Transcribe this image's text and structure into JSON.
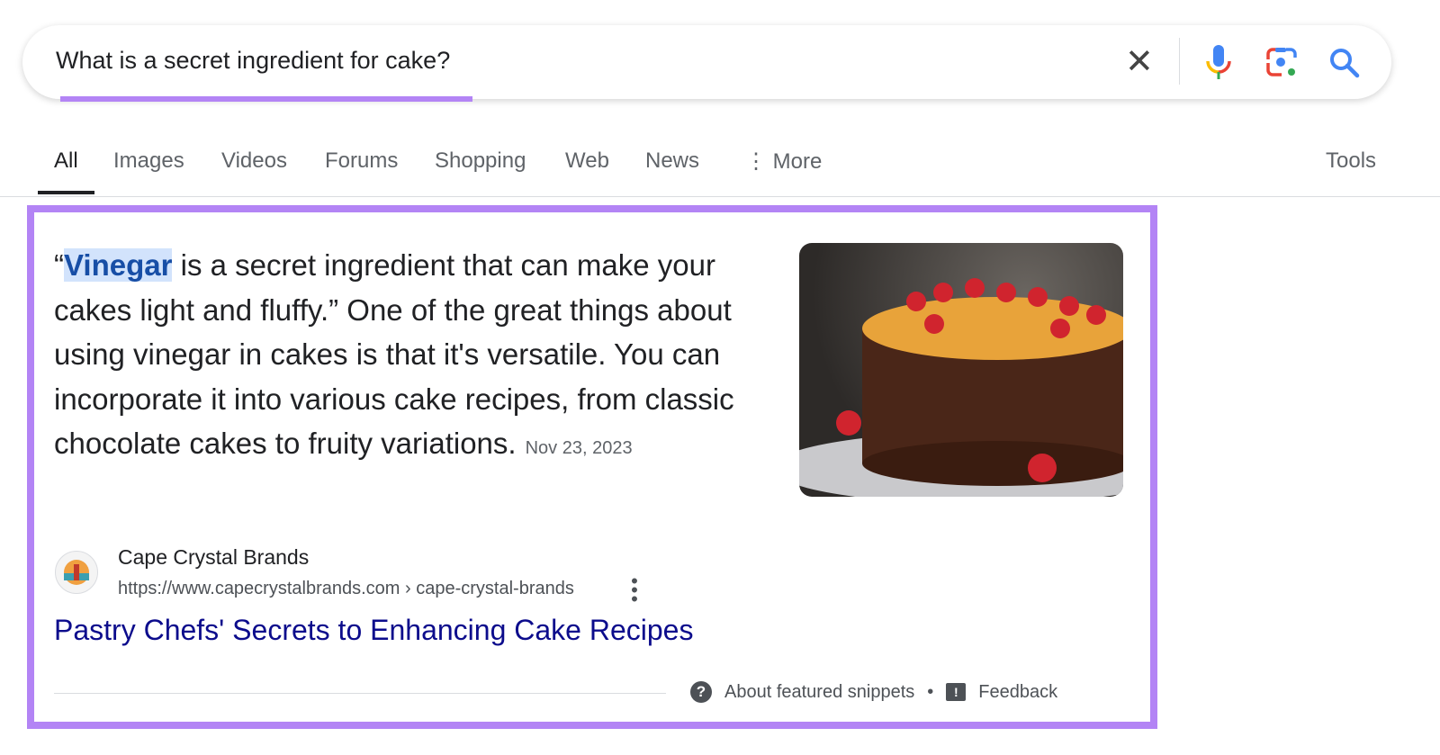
{
  "search": {
    "query": "What is a secret ingredient for cake?",
    "clear_icon": "close-icon",
    "voice_icon": "microphone-icon",
    "lens_icon": "google-lens-icon",
    "search_icon": "search-icon",
    "highlight_color": "#b384f5"
  },
  "tabs": [
    {
      "label": "All",
      "active": true
    },
    {
      "label": "Images"
    },
    {
      "label": "Videos"
    },
    {
      "label": "Forums"
    },
    {
      "label": "Shopping"
    },
    {
      "label": "Web"
    },
    {
      "label": "News"
    },
    {
      "label": "More"
    }
  ],
  "tools_label": "Tools",
  "snippet": {
    "open_quote": "“",
    "highlight": "Vinegar",
    "text": " is a secret ingredient that can make your cakes light and fluffy.” One of the great things about using vinegar in cakes is that it's versatile. You can incorporate it into various cake recipes, from classic chocolate cakes to fruity variations.",
    "date": "Nov 23, 2023",
    "image": "chocolate-cake-with-strawberries",
    "source_name": "Cape Crystal Brands",
    "source_url": "https://www.capecrystalbrands.com › cape-crystal-brands",
    "title": "Pastry Chefs' Secrets to Enhancing Cake Recipes",
    "about_label": "About featured snippets",
    "separator": "•",
    "feedback_label": "Feedback"
  }
}
